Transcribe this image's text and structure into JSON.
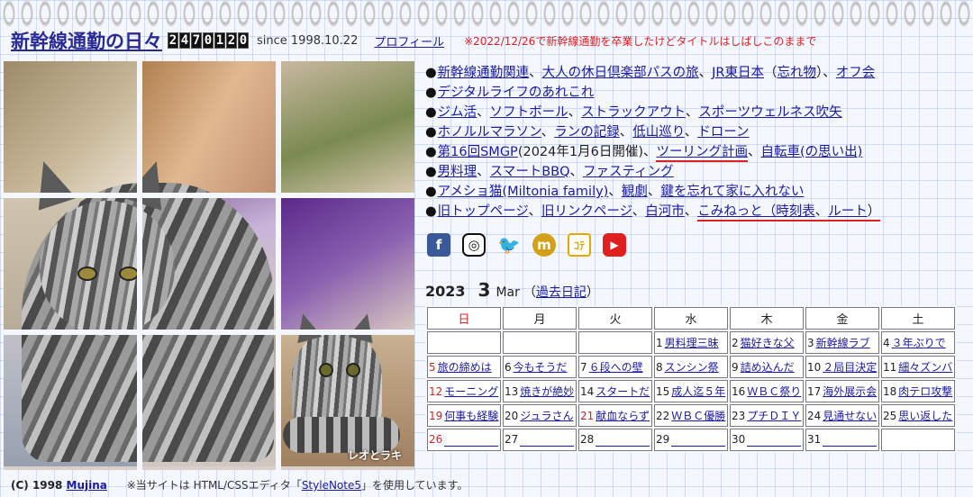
{
  "header": {
    "title": "新幹線通勤の日々",
    "counter": [
      "2",
      "4",
      "7",
      "0",
      "1",
      "2",
      "0"
    ],
    "since": "since 1998.10.22",
    "profile": "プロフィール",
    "notice": "※2022/12/26で新幹線通勤を卒業したけどタイトルはしばしこのままで"
  },
  "photo": {
    "caption": "レオとラキ"
  },
  "menu": {
    "r1": [
      "新幹線通勤関連",
      "、",
      "大人の休日倶楽部パスの旅",
      "、",
      "JR東日本",
      "（",
      "忘れ物",
      "）、",
      "オフ会"
    ],
    "r2": [
      "デジタルライフのあれこれ"
    ],
    "r3": [
      "ジム活",
      "、",
      "ソフトボール",
      "、",
      "ストラックアウト",
      "、",
      "スポーツウェルネス吹矢"
    ],
    "r4": [
      "ホノルルマラソン",
      "、",
      "ランの記録",
      "、",
      "低山巡り",
      "、",
      "ドローン"
    ],
    "r5": [
      "第16回SMGP",
      "(2024年1月6日開催)、",
      "ツーリング計画",
      "、",
      "自転車(の思い出)"
    ],
    "r6": [
      "男料理",
      "、",
      "スマートBBQ",
      "、",
      "ファスティング"
    ],
    "r7": [
      "アメショ猫(Miltonia family)",
      "、",
      "観劇",
      "、",
      "鍵を忘れて家に入れない"
    ],
    "r8": [
      "旧トップページ",
      "、",
      "旧リンクページ",
      "、",
      "白河市",
      "、",
      "こみねっと（",
      "時刻表",
      "、",
      "ルート",
      "）"
    ]
  },
  "social": {
    "facebook": "f",
    "instagram": "◎",
    "twitter": "🐦",
    "mixi": "m",
    "app": "ｺﾃ",
    "youtube": "▶"
  },
  "calendar": {
    "year": "2023",
    "month": "3",
    "month_name": "Mar",
    "past_open": "（",
    "past": "過去日記",
    "past_close": "）",
    "weekdays": [
      "日",
      "月",
      "火",
      "水",
      "木",
      "金",
      "土"
    ],
    "weeks": [
      [
        [
          "",
          ""
        ],
        [
          "",
          ""
        ],
        [
          "",
          ""
        ],
        [
          "1",
          "男料理三昧"
        ],
        [
          "2",
          "猫好きな父"
        ],
        [
          "3",
          "新幹線ラブ"
        ],
        [
          "4",
          "３年ぶりで"
        ]
      ],
      [
        [
          "5",
          "旅の締めは"
        ],
        [
          "6",
          "今もそうだ"
        ],
        [
          "7",
          "６段への壁"
        ],
        [
          "8",
          "スンシン祭"
        ],
        [
          "9",
          "詰め込んだ"
        ],
        [
          "10",
          "２局目決定"
        ],
        [
          "11",
          "細々ズンバ"
        ]
      ],
      [
        [
          "12",
          "モーニング"
        ],
        [
          "13",
          "焼きが絶妙"
        ],
        [
          "14",
          "スタートだ"
        ],
        [
          "15",
          "成人迄５年"
        ],
        [
          "16",
          "ＷＢＣ祭り"
        ],
        [
          "17",
          "海外展示会"
        ],
        [
          "18",
          "肉テロ攻撃"
        ]
      ],
      [
        [
          "19",
          "何事も経験"
        ],
        [
          "20",
          "ジュラさん"
        ],
        [
          "21",
          "献血ならず"
        ],
        [
          "22",
          "ＷＢＣ優勝"
        ],
        [
          "23",
          "プチＤＩＹ"
        ],
        [
          "24",
          "見通せない"
        ],
        [
          "25",
          "思い返した"
        ]
      ],
      [
        [
          "26",
          ""
        ],
        [
          "27",
          ""
        ],
        [
          "28",
          ""
        ],
        [
          "29",
          ""
        ],
        [
          "30",
          ""
        ],
        [
          "31",
          ""
        ],
        [
          "",
          ""
        ]
      ]
    ]
  },
  "footer": {
    "copy": "(C) 1998 ",
    "author": "Mujina",
    "note_pre": "※当サイトは HTML/CSSエディタ「",
    "note_link": "StyleNote5",
    "note_post": "」を使用しています。"
  }
}
